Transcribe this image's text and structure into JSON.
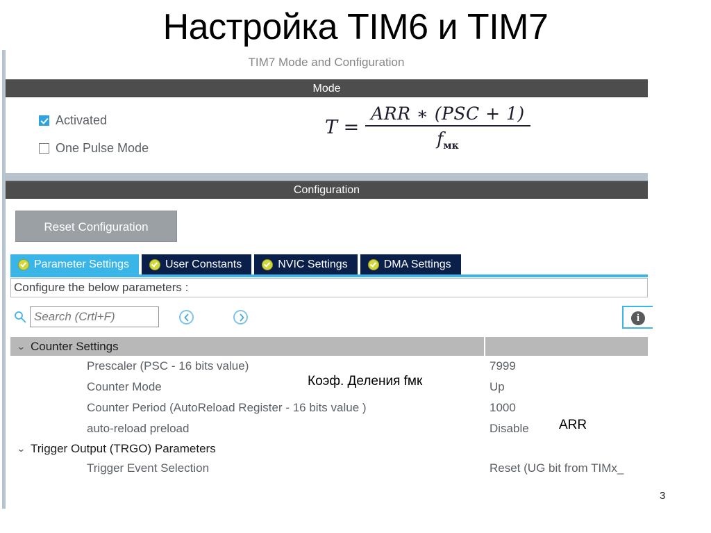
{
  "slide": {
    "title": "Настройка TIM6 и TIM7",
    "page_number": "3"
  },
  "panel": {
    "subtitle": "TIM7 Mode and Configuration",
    "mode_header": "Mode",
    "configuration_header": "Configuration"
  },
  "mode": {
    "checkboxes": [
      {
        "label": "Activated",
        "checked": true
      },
      {
        "label": "One Pulse Mode",
        "checked": false
      }
    ]
  },
  "formula": {
    "lhs": "T =",
    "numerator": "ARR ∗ (PSC + 1)",
    "denominator_base": "f",
    "denominator_sub": "мк"
  },
  "configuration": {
    "reset_button": "Reset Configuration",
    "tabs": [
      {
        "label": "Parameter Settings",
        "active": true,
        "icon": "check-circle-icon"
      },
      {
        "label": "User Constants",
        "active": false,
        "icon": "check-circle-icon"
      },
      {
        "label": "NVIC Settings",
        "active": false,
        "icon": "check-circle-icon"
      },
      {
        "label": "DMA Settings",
        "active": false,
        "icon": "check-circle-icon"
      }
    ],
    "configure_line": "Configure the below parameters :",
    "search": {
      "placeholder": "Search (Crtl+F)",
      "value": "",
      "icon": "search-icon"
    },
    "nav": {
      "prev_icon": "chevron-left-circle-icon",
      "next_icon": "chevron-right-circle-icon"
    },
    "info_button": {
      "icon": "info-icon",
      "glyph": "i"
    }
  },
  "parameters": {
    "groups": [
      {
        "name": "Counter Settings",
        "caret": "⌄",
        "rows": [
          {
            "label": "Prescaler (PSC - 16 bits value)",
            "value": "7999"
          },
          {
            "label": "Counter Mode",
            "value": "Up"
          },
          {
            "label": "Counter Period (AutoReload Register - 16 bits value )",
            "value": "1000"
          },
          {
            "label": "auto-reload preload",
            "value": "Disable"
          }
        ]
      },
      {
        "name": "Trigger Output (TRGO) Parameters",
        "caret": "⌄",
        "rows": [
          {
            "label": "Trigger Event Selection",
            "value": "Reset (UG bit from TIMx_"
          }
        ]
      }
    ]
  },
  "annotations": {
    "prescaler_note": "Коэф. Деления fмк",
    "period_note": "ARR"
  },
  "colors": {
    "header_bar": "#4d4d4d",
    "active_tab": "#3ab5e8",
    "inactive_tab": "#0b1f4b",
    "tab_icon": "#d2d83b",
    "group_row": "#b8b8b8",
    "reset_button": "#9ba0a5",
    "checkbox_checked": "#2fa3dd",
    "rail": "#b6c2cc"
  }
}
